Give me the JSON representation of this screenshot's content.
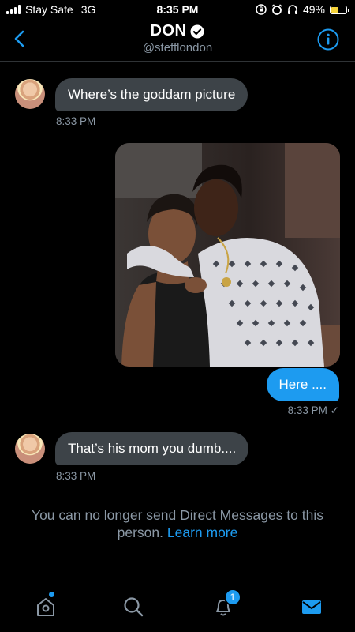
{
  "status_bar": {
    "carrier": "Stay Safe",
    "network": "3G",
    "time": "8:35 PM",
    "battery_percent": "49%",
    "battery_level": 0.49
  },
  "header": {
    "name": "DON",
    "handle": "@stefflondon",
    "back_icon": "chevron-left-icon",
    "verified_icon": "verified-badge-icon",
    "info_icon": "info-icon"
  },
  "messages": [
    {
      "direction": "in",
      "text": "Where’s the goddam picture",
      "time": "8:33 PM"
    },
    {
      "direction": "out",
      "type": "image",
      "image_icon": "photo-image"
    },
    {
      "direction": "out",
      "text": "Here ....",
      "time": "8:33 PM ✓"
    },
    {
      "direction": "in",
      "text": "That’s his mom you dumb....",
      "time": "8:33 PM"
    }
  ],
  "notice": {
    "text": "You can no longer send Direct Messages to this person.",
    "link": "Learn more"
  },
  "tabbar": {
    "home_icon": "home-icon",
    "search_icon": "search-icon",
    "notifications_icon": "bell-icon",
    "notifications_count": "1",
    "messages_icon": "mail-icon"
  },
  "colors": {
    "accent": "#1d9bf0",
    "incoming_bubble": "#3d4348",
    "secondary_text": "#8b98a5",
    "battery": "#f5d33b"
  }
}
